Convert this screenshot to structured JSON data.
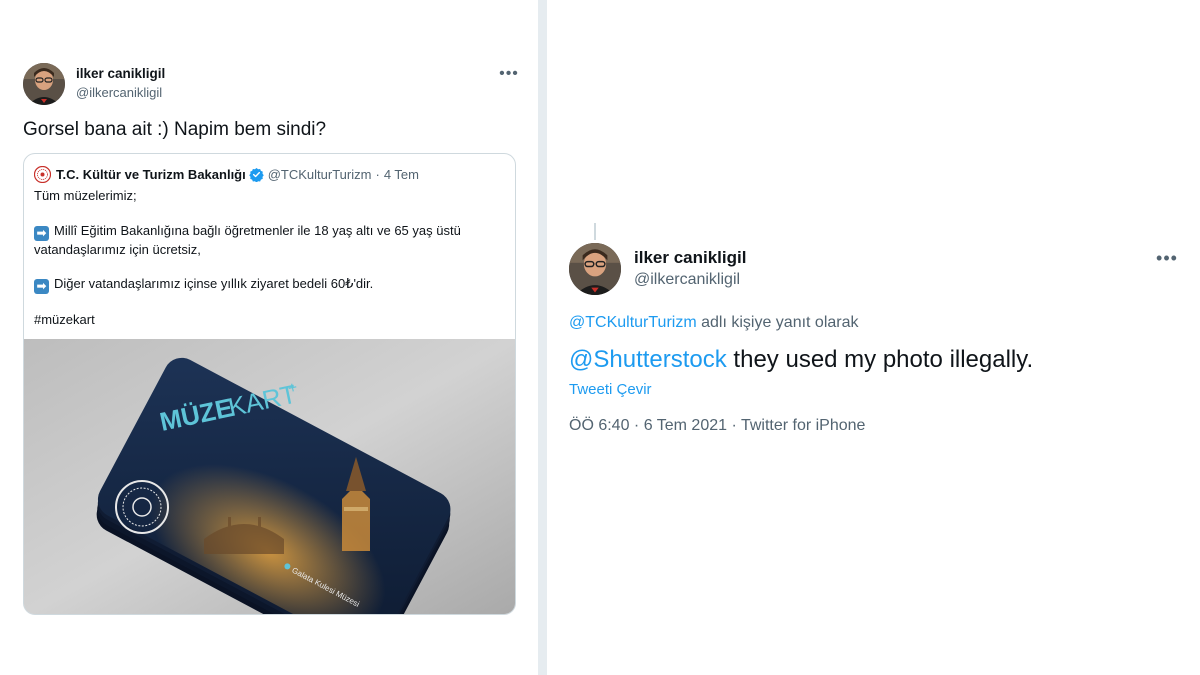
{
  "left_tweet": {
    "author_name": "ilker canikligil",
    "author_handle": "@ilkercanikligil",
    "more_icon": "more-horizontal-icon",
    "text": "Gorsel bana ait :) Napim bem sindi?",
    "quoted": {
      "author_name": "T.C. Kültür ve Turizm Bakanlığı",
      "verified_icon": "verified-badge-icon",
      "author_handle": "@TCKulturTurizm",
      "separator": "·",
      "date": "4 Tem",
      "lines": {
        "l1": "Tüm müzelerimiz;",
        "l2a": "Millî Eğitim Bakanlığına bağlı öğretmenler ile 18 yaş altı ve 65 yaş üstü",
        "l2b": "vatandaşlarımız için ücretsiz,",
        "l3": "Diğer vatandaşlarımız içinse yıllık ziyaret bedeli 60₺'dir.",
        "l4": "#müzekart"
      },
      "arrow_emoji": "➡",
      "media": {
        "card_brand_bold": "MÜZE",
        "card_brand_light": "KART",
        "card_plus": "+",
        "card_location": "Galata Kulesi Müzesi"
      }
    }
  },
  "right_tweet": {
    "author_name": "ilker canikligil",
    "author_handle": "@ilkercanikligil",
    "more_icon": "more-horizontal-icon",
    "reply_to_handle": "@TCKulturTurizm",
    "reply_to_suffix": " adlı kişiye yanıt olarak",
    "mention": "@Shutterstock",
    "text": " they used my photo illegally.",
    "translate_label": "Tweeti Çevir",
    "meta": "ÖÖ 6:40 · 6 Tem 2021 · Twitter for iPhone"
  },
  "colors": {
    "link": "#1d9bf0",
    "secondary_text": "#536471",
    "divider": "#e6ecf0",
    "card_navy": "#15233f"
  }
}
